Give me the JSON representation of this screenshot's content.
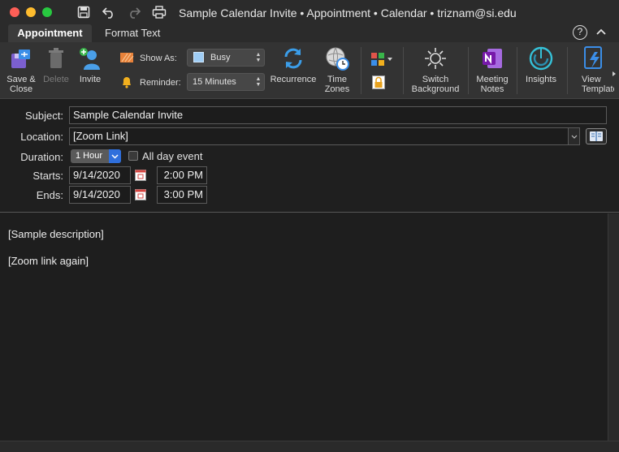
{
  "window": {
    "title": "Sample Calendar Invite • Appointment • Calendar • triznam@si.edu"
  },
  "tabs": [
    {
      "label": "Appointment",
      "active": true
    },
    {
      "label": "Format Text",
      "active": false
    }
  ],
  "help": {
    "label": "?"
  },
  "ribbon": {
    "save_close": "Save &\nClose",
    "save_close_l1": "Save &",
    "save_close_l2": "Close",
    "delete": "Delete",
    "invite": "Invite",
    "show_as_label": "Show As:",
    "show_as_value": "Busy",
    "reminder_label": "Reminder:",
    "reminder_value": "15 Minutes",
    "recurrence": "Recurrence",
    "time_zones_l1": "Time",
    "time_zones_l2": "Zones",
    "switch_bg_l1": "Switch",
    "switch_bg_l2": "Background",
    "meeting_notes_l1": "Meeting",
    "meeting_notes_l2": "Notes",
    "insights": "Insights",
    "view_templates_l1": "View",
    "view_templates_l2": "Templates"
  },
  "form": {
    "subject_label": "Subject:",
    "subject_value": "Sample Calendar Invite",
    "location_label": "Location:",
    "location_value": "[Zoom Link]",
    "duration_label": "Duration:",
    "duration_value": "1 Hour",
    "all_day_label": "All day event",
    "starts_label": "Starts:",
    "start_date": "9/14/2020",
    "start_time": "2:00 PM",
    "ends_label": "Ends:",
    "end_date": "9/14/2020",
    "end_time": "3:00 PM"
  },
  "body": {
    "lines": [
      "[Sample description]",
      "[Zoom link again]"
    ]
  },
  "colors": {
    "close": "#fe5f57",
    "minimize": "#febc2e",
    "maximize": "#28c840",
    "accent": "#2f6fdc"
  }
}
